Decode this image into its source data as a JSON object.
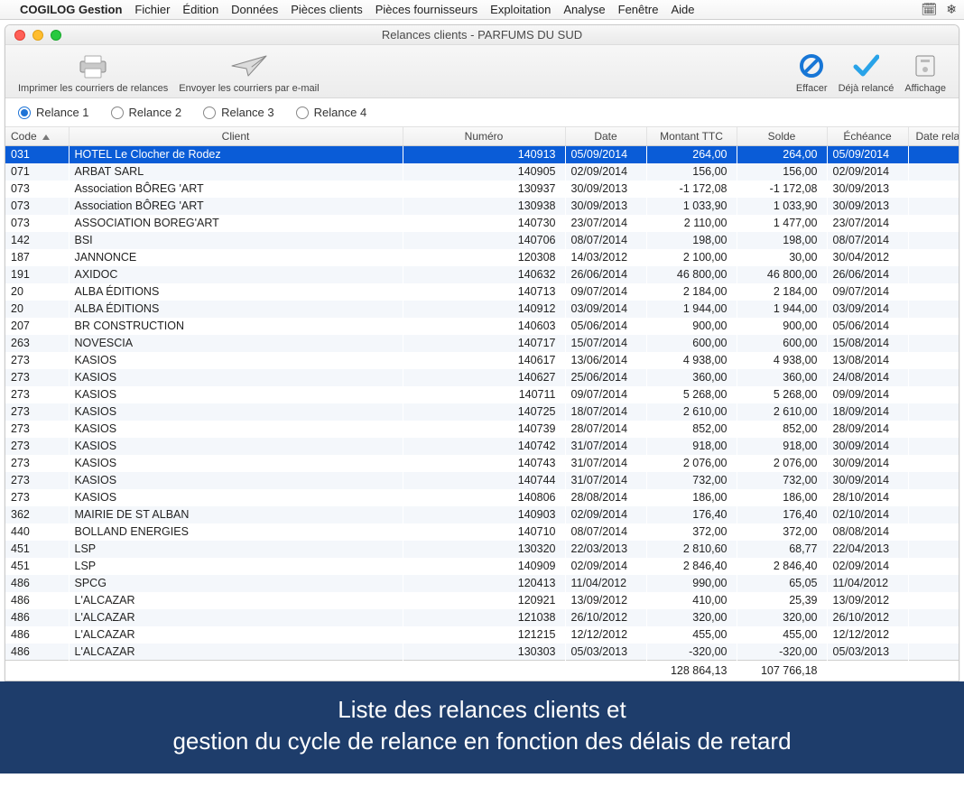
{
  "menubar": {
    "apple": "",
    "app": "COGILOG Gestion",
    "items": [
      "Fichier",
      "Édition",
      "Données",
      "Pièces clients",
      "Pièces fournisseurs",
      "Exploitation",
      "Analyse",
      "Fenêtre",
      "Aide"
    ],
    "right_icons": [
      "calendar-icon",
      "gear-icon"
    ]
  },
  "window": {
    "title": "Relances clients - PARFUMS DU SUD"
  },
  "toolbar": {
    "print_label": "Imprimer les courriers de relances",
    "email_label": "Envoyer les courriers par e-mail",
    "clear_label": "Effacer",
    "done_label": "Déjà relancé",
    "display_label": "Affichage"
  },
  "radios": {
    "items": [
      "Relance 1",
      "Relance 2",
      "Relance 3",
      "Relance 4"
    ],
    "selected_index": 0
  },
  "columns": [
    "Code",
    "Client",
    "Numéro",
    "Date",
    "Montant TTC",
    "Solde",
    "Échéance",
    "Date relance"
  ],
  "rows": [
    {
      "code": "031",
      "client": "HOTEL Le Clocher de Rodez",
      "numero": "140913",
      "date": "05/09/2014",
      "montant": "264,00",
      "solde": "264,00",
      "echeance": "05/09/2014",
      "date_relance": "",
      "selected": true
    },
    {
      "code": "071",
      "client": "ARBAT SARL",
      "numero": "140905",
      "date": "02/09/2014",
      "montant": "156,00",
      "solde": "156,00",
      "echeance": "02/09/2014",
      "date_relance": ""
    },
    {
      "code": "073",
      "client": "Association BÔREG 'ART",
      "numero": "130937",
      "date": "30/09/2013",
      "montant": "-1 172,08",
      "solde": "-1 172,08",
      "echeance": "30/09/2013",
      "date_relance": ""
    },
    {
      "code": "073",
      "client": "Association BÔREG 'ART",
      "numero": "130938",
      "date": "30/09/2013",
      "montant": "1 033,90",
      "solde": "1 033,90",
      "echeance": "30/09/2013",
      "date_relance": ""
    },
    {
      "code": "073",
      "client": "ASSOCIATION BOREG'ART",
      "numero": "140730",
      "date": "23/07/2014",
      "montant": "2 110,00",
      "solde": "1 477,00",
      "echeance": "23/07/2014",
      "date_relance": ""
    },
    {
      "code": "142",
      "client": "BSI",
      "numero": "140706",
      "date": "08/07/2014",
      "montant": "198,00",
      "solde": "198,00",
      "echeance": "08/07/2014",
      "date_relance": ""
    },
    {
      "code": "187",
      "client": "JANNONCE",
      "numero": "120308",
      "date": "14/03/2012",
      "montant": "2 100,00",
      "solde": "30,00",
      "echeance": "30/04/2012",
      "date_relance": ""
    },
    {
      "code": "191",
      "client": "AXIDOC",
      "numero": "140632",
      "date": "26/06/2014",
      "montant": "46 800,00",
      "solde": "46 800,00",
      "echeance": "26/06/2014",
      "date_relance": ""
    },
    {
      "code": "20",
      "client": "ALBA ÉDITIONS",
      "numero": "140713",
      "date": "09/07/2014",
      "montant": "2 184,00",
      "solde": "2 184,00",
      "echeance": "09/07/2014",
      "date_relance": ""
    },
    {
      "code": "20",
      "client": "ALBA ÉDITIONS",
      "numero": "140912",
      "date": "03/09/2014",
      "montant": "1 944,00",
      "solde": "1 944,00",
      "echeance": "03/09/2014",
      "date_relance": ""
    },
    {
      "code": "207",
      "client": "BR CONSTRUCTION",
      "numero": "140603",
      "date": "05/06/2014",
      "montant": "900,00",
      "solde": "900,00",
      "echeance": "05/06/2014",
      "date_relance": ""
    },
    {
      "code": "263",
      "client": "NOVESCIA",
      "numero": "140717",
      "date": "15/07/2014",
      "montant": "600,00",
      "solde": "600,00",
      "echeance": "15/08/2014",
      "date_relance": ""
    },
    {
      "code": "273",
      "client": "KASIOS",
      "numero": "140617",
      "date": "13/06/2014",
      "montant": "4 938,00",
      "solde": "4 938,00",
      "echeance": "13/08/2014",
      "date_relance": ""
    },
    {
      "code": "273",
      "client": "KASIOS",
      "numero": "140627",
      "date": "25/06/2014",
      "montant": "360,00",
      "solde": "360,00",
      "echeance": "24/08/2014",
      "date_relance": ""
    },
    {
      "code": "273",
      "client": "KASIOS",
      "numero": "140711",
      "date": "09/07/2014",
      "montant": "5 268,00",
      "solde": "5 268,00",
      "echeance": "09/09/2014",
      "date_relance": ""
    },
    {
      "code": "273",
      "client": "KASIOS",
      "numero": "140725",
      "date": "18/07/2014",
      "montant": "2 610,00",
      "solde": "2 610,00",
      "echeance": "18/09/2014",
      "date_relance": ""
    },
    {
      "code": "273",
      "client": "KASIOS",
      "numero": "140739",
      "date": "28/07/2014",
      "montant": "852,00",
      "solde": "852,00",
      "echeance": "28/09/2014",
      "date_relance": ""
    },
    {
      "code": "273",
      "client": "KASIOS",
      "numero": "140742",
      "date": "31/07/2014",
      "montant": "918,00",
      "solde": "918,00",
      "echeance": "30/09/2014",
      "date_relance": ""
    },
    {
      "code": "273",
      "client": "KASIOS",
      "numero": "140743",
      "date": "31/07/2014",
      "montant": "2 076,00",
      "solde": "2 076,00",
      "echeance": "30/09/2014",
      "date_relance": ""
    },
    {
      "code": "273",
      "client": "KASIOS",
      "numero": "140744",
      "date": "31/07/2014",
      "montant": "732,00",
      "solde": "732,00",
      "echeance": "30/09/2014",
      "date_relance": ""
    },
    {
      "code": "273",
      "client": "KASIOS",
      "numero": "140806",
      "date": "28/08/2014",
      "montant": "186,00",
      "solde": "186,00",
      "echeance": "28/10/2014",
      "date_relance": ""
    },
    {
      "code": "362",
      "client": "MAIRIE  DE ST ALBAN",
      "numero": "140903",
      "date": "02/09/2014",
      "montant": "176,40",
      "solde": "176,40",
      "echeance": "02/10/2014",
      "date_relance": ""
    },
    {
      "code": "440",
      "client": "BOLLAND ENERGIES",
      "numero": "140710",
      "date": "08/07/2014",
      "montant": "372,00",
      "solde": "372,00",
      "echeance": "08/08/2014",
      "date_relance": ""
    },
    {
      "code": "451",
      "client": "LSP",
      "numero": "130320",
      "date": "22/03/2013",
      "montant": "2 810,60",
      "solde": "68,77",
      "echeance": "22/04/2013",
      "date_relance": ""
    },
    {
      "code": "451",
      "client": "LSP",
      "numero": "140909",
      "date": "02/09/2014",
      "montant": "2 846,40",
      "solde": "2 846,40",
      "echeance": "02/09/2014",
      "date_relance": ""
    },
    {
      "code": "486",
      "client": "SPCG",
      "numero": "120413",
      "date": "11/04/2012",
      "montant": "990,00",
      "solde": "65,05",
      "echeance": "11/04/2012",
      "date_relance": ""
    },
    {
      "code": "486",
      "client": "L'ALCAZAR",
      "numero": "120921",
      "date": "13/09/2012",
      "montant": "410,00",
      "solde": "25,39",
      "echeance": "13/09/2012",
      "date_relance": ""
    },
    {
      "code": "486",
      "client": "L'ALCAZAR",
      "numero": "121038",
      "date": "26/10/2012",
      "montant": "320,00",
      "solde": "320,00",
      "echeance": "26/10/2012",
      "date_relance": ""
    },
    {
      "code": "486",
      "client": "L'ALCAZAR",
      "numero": "121215",
      "date": "12/12/2012",
      "montant": "455,00",
      "solde": "455,00",
      "echeance": "12/12/2012",
      "date_relance": ""
    },
    {
      "code": "486",
      "client": "L'ALCAZAR",
      "numero": "130303",
      "date": "05/03/2013",
      "montant": "-320,00",
      "solde": "-320,00",
      "echeance": "05/03/2013",
      "date_relance": ""
    }
  ],
  "totals": {
    "montant": "128 864,13",
    "solde": "107 766,18"
  },
  "footer": {
    "line1": "Liste des relances clients et",
    "line2": "gestion du cycle de relance en fonction des délais de retard"
  }
}
